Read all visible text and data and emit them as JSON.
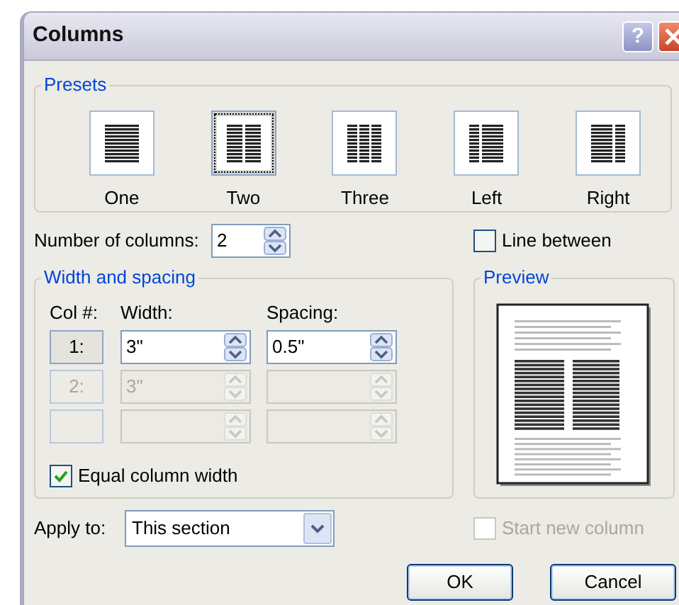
{
  "window": {
    "title": "Columns",
    "help_button": "?"
  },
  "presets": {
    "title": "Presets",
    "items": [
      {
        "label": "One",
        "kind": "one",
        "selected": false
      },
      {
        "label": "Two",
        "kind": "two",
        "selected": true
      },
      {
        "label": "Three",
        "kind": "three",
        "selected": false
      },
      {
        "label": "Left",
        "kind": "left",
        "selected": false
      },
      {
        "label": "Right",
        "kind": "right",
        "selected": false
      }
    ]
  },
  "number_of_columns": {
    "label": "Number of columns:",
    "value": "2"
  },
  "line_between": {
    "label": "Line between",
    "checked": false
  },
  "width_and_spacing": {
    "title": "Width and spacing",
    "headers": [
      "Col #:",
      "Width:",
      "Spacing:"
    ],
    "rows": [
      {
        "col": "1:",
        "width": "3\"",
        "spacing": "0.5\"",
        "disabled": false
      },
      {
        "col": "2:",
        "width": "3\"",
        "disabled": true
      },
      {
        "disabled": true
      }
    ]
  },
  "equal_column_width": {
    "label": "Equal column width",
    "checked": true
  },
  "preview": {
    "title": "Preview"
  },
  "apply_to": {
    "label": "Apply to:",
    "value": "This section"
  },
  "start_new_column": {
    "label": "Start new column",
    "checked": false,
    "disabled": true
  },
  "buttons": [
    "OK",
    "Cancel"
  ]
}
